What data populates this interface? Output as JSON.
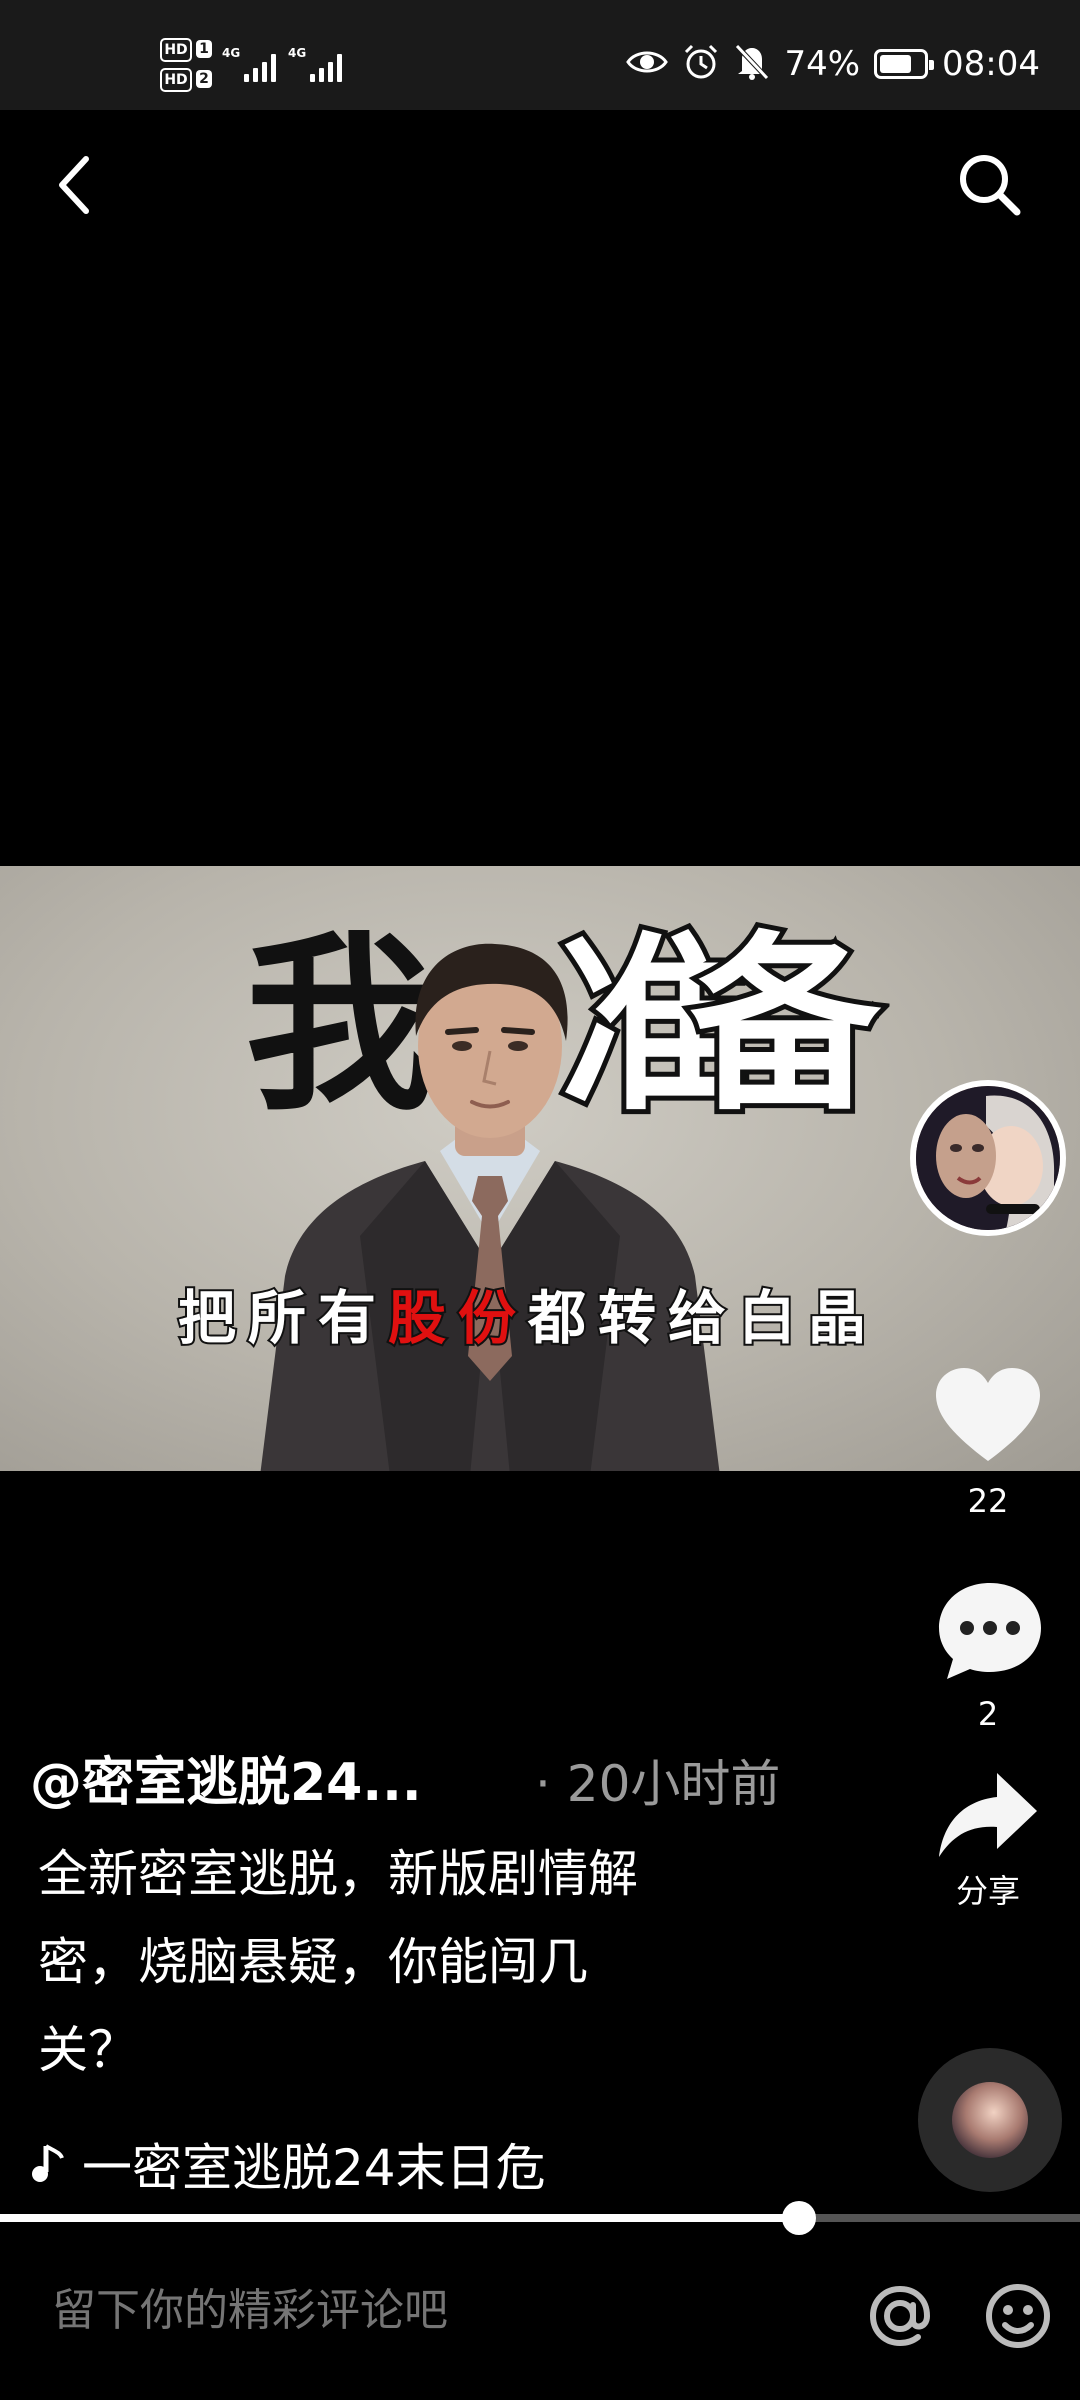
{
  "status_bar": {
    "hd1": "HD",
    "sim1": "1",
    "hd2": "HD",
    "sim2": "2",
    "net1": "4G",
    "net2": "4G",
    "battery_percent": "74%",
    "battery_level": 0.74,
    "time": "08:04",
    "icons": [
      "eye-icon",
      "alarm-icon",
      "mute-bell-icon"
    ]
  },
  "top_bar": {
    "back_icon": "chevron-left-icon",
    "search_icon": "search-icon"
  },
  "video": {
    "title_left": "我",
    "title_mid": "准",
    "title_right": "备",
    "subtitle_parts": [
      "把所有",
      "股份",
      "都转给白晶"
    ]
  },
  "actions": {
    "like_count": "22",
    "comment_count": "2",
    "share_label": "分享"
  },
  "post": {
    "author": "@密室逃脱24...",
    "time": "· 20小时前",
    "description_lines": [
      "全新密室逃脱，新版剧情解",
      "密，烧脑悬疑，你能闯几",
      "关？"
    ],
    "music": "一密室逃脱24末日危"
  },
  "progress": {
    "played_fraction": 0.74
  },
  "comment": {
    "placeholder": "留下你的精彩评论吧"
  },
  "colors": {
    "highlight_red": "#e01010",
    "muted_text": "#9a9a9a"
  }
}
